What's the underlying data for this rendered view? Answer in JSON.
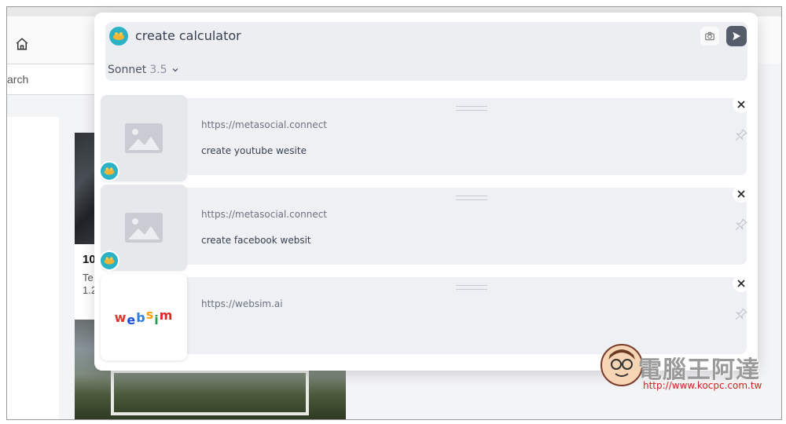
{
  "background": {
    "search_partial": "arch",
    "card_title_partial": "10",
    "card_sub_1_partial": "Te",
    "card_sub_2_partial": "1.2"
  },
  "prompt": {
    "value": "create calculator",
    "model_name": "Sonnet",
    "model_version": "3.5"
  },
  "results": [
    {
      "url": "https://metasocial.connect",
      "description": "create youtube wesite",
      "thumbnail": "image-placeholder-icon"
    },
    {
      "url": "https://metasocial.connect",
      "description": "create facebook websit",
      "thumbnail": "image-placeholder-icon"
    },
    {
      "url": "https://websim.ai",
      "description": "",
      "thumbnail": "websim-logo"
    }
  ],
  "websim_logo": [
    "w",
    "e",
    "b",
    "s",
    "i",
    "m"
  ],
  "watermark": {
    "title": "電腦王阿達",
    "url": "http://www.kocpc.com.tw"
  },
  "colors": {
    "accent_avatar": "#2bb3c5",
    "send_button": "#555d6a",
    "prompt_bg": "#eceef2",
    "result_bg": "#eef0f3"
  }
}
